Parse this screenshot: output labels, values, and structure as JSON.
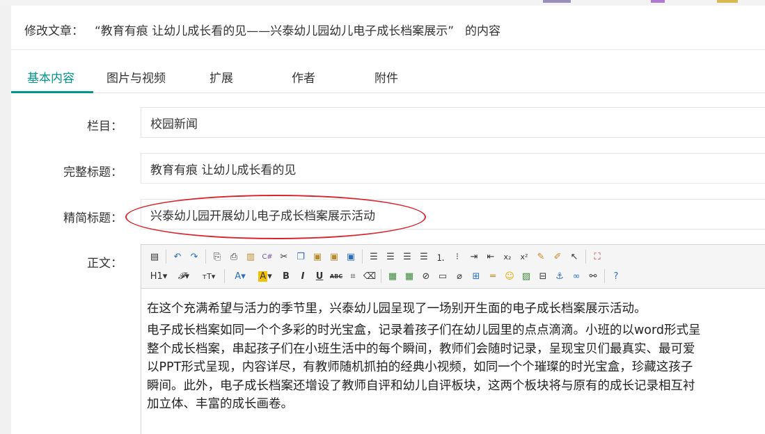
{
  "page": {
    "title_prefix": "修改文章：",
    "title_quoted": "“教育有痕 让幼儿成长看的见——兴泰幼儿园幼儿电子成长档案展示”",
    "title_suffix": "的内容"
  },
  "tabs": [
    {
      "label": "基本内容",
      "active": true
    },
    {
      "label": "图片与视频"
    },
    {
      "label": "扩展"
    },
    {
      "label": "作者"
    },
    {
      "label": "附件"
    }
  ],
  "form": {
    "column": {
      "label": "栏目：",
      "value": "校园新闻"
    },
    "full_title": {
      "label": "完整标题：",
      "value": "教育有痕 让幼儿成长看的见"
    },
    "short_title": {
      "label": "精简标题：",
      "value": "兴泰幼儿园开展幼儿电子成长档案展示活动"
    },
    "body_label": "正文："
  },
  "toolbar": {
    "row1": [
      "source-icon",
      "undo-icon",
      "redo-icon",
      "preview-icon",
      "print-icon",
      "template-icon",
      "code-icon",
      "cut-icon",
      "copy-icon",
      "paste-icon",
      "paste-text-icon",
      "paste-word-icon",
      "align-left-icon",
      "align-center-icon",
      "align-right-icon",
      "justify-icon",
      "ordered-list-icon",
      "unordered-list-icon",
      "indent-icon",
      "outdent-icon",
      "subscript-icon",
      "superscript-icon",
      "clear-format-icon",
      "select-all-icon",
      "cursor-icon",
      "fullscreen-icon"
    ],
    "row2_text": {
      "heading": "H1",
      "font": "𝓕",
      "size": "тT",
      "fore_color": "A",
      "back_color": "A",
      "bold": "B",
      "italic": "I",
      "underline": "U",
      "strike": "ABC"
    }
  },
  "content": {
    "paragraphs": [
      "在这个充满希望与活力的季节里，兴泰幼儿园呈现了一场别开生面的电子成长档案展示活动。",
      "电子成长档案如同一个个多彩的时光宝盒，记录着孩子们在幼儿园里的点点滴滴。小班的以word形式呈",
      "整个成长档案，串起孩子们在小班生活中的每个瞬间，教师们会随时记录，呈现宝贝们最真实、最可爱",
      "以PPT形式呈现，内容详尽，有教师随机抓拍的经典小视频，如同一个个璀璨的时光宝盒，珍藏这孩子",
      "瞬间。此外，电子成长档案还增设了教师自评和幼儿自评板块，这两个板块将与原有的成长记录相互衬",
      "加立体、丰富的成长画卷。"
    ]
  },
  "colors": {
    "accent": "#009688",
    "annotation": "#d8262e"
  }
}
